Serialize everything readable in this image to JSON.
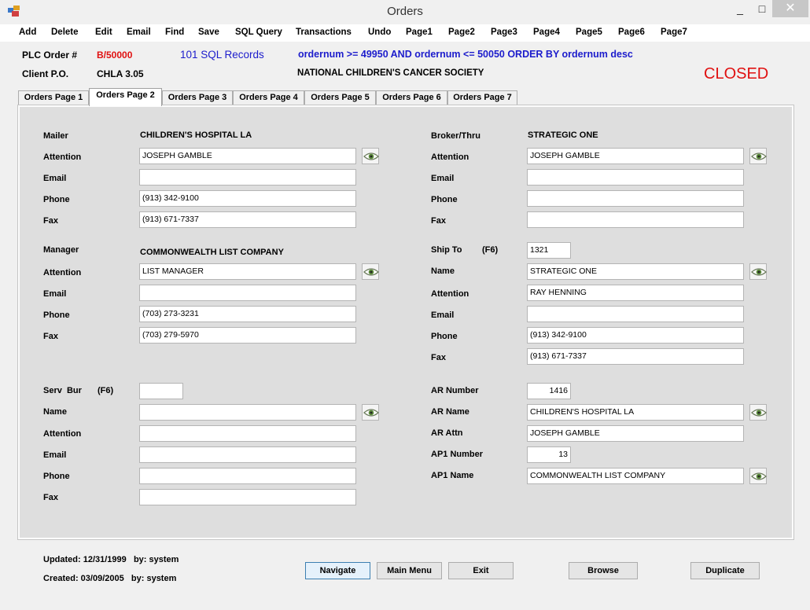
{
  "window": {
    "title": "Orders",
    "minimize": "_",
    "maximize": "□",
    "close": "✕"
  },
  "menu": [
    "Add",
    "Delete",
    "Edit",
    "Email",
    "Find",
    "Save",
    "SQL Query",
    "Transactions",
    "Undo",
    "Page1",
    "Page2",
    "Page3",
    "Page4",
    "Page5",
    "Page6",
    "Page7"
  ],
  "header": {
    "order_label": "PLC Order #",
    "order_value": "B/50000",
    "records": "101 SQL Records",
    "query": "ordernum >= 49950 AND ordernum <= 50050 ORDER BY ordernum desc",
    "client_po_label": "Client P.O.",
    "client_po_value": "CHLA 3.05",
    "client_name": "NATIONAL CHILDREN'S CANCER SOCIETY",
    "status": "CLOSED",
    "status_color": "#e01010",
    "accent_blue": "#1c1ccc"
  },
  "tabs": [
    "Orders Page 1",
    "Orders Page 2",
    "Orders Page 3",
    "Orders Page 4",
    "Orders Page 5",
    "Orders Page 6",
    "Orders Page 7"
  ],
  "active_tab": "Orders Page 2",
  "mailer": {
    "label": "Mailer",
    "name": "CHILDREN'S HOSPITAL LA",
    "attention_label": "Attention",
    "attention": "JOSEPH GAMBLE",
    "email_label": "Email",
    "email": "",
    "phone_label": "Phone",
    "phone": "(913) 342-9100",
    "fax_label": "Fax",
    "fax": "(913) 671-7337"
  },
  "manager": {
    "label": "Manager",
    "name": "COMMONWEALTH LIST COMPANY",
    "attention_label": "Attention",
    "attention": "LIST MANAGER",
    "email_label": "Email",
    "email": "",
    "phone_label": "Phone",
    "phone": "(703) 273-3231",
    "fax_label": "Fax",
    "fax": "(703) 279-5970"
  },
  "serv_bur": {
    "label": "Serv  Bur",
    "key_hint": "(F6)",
    "code": "",
    "name_label": "Name",
    "name": "",
    "attention_label": "Attention",
    "attention": "",
    "email_label": "Email",
    "email": "",
    "phone_label": "Phone",
    "phone": "",
    "fax_label": "Fax",
    "fax": ""
  },
  "broker": {
    "label": "Broker/Thru",
    "name": "STRATEGIC ONE",
    "attention_label": "Attention",
    "attention": "JOSEPH GAMBLE",
    "email_label": "Email",
    "email": "",
    "phone_label": "Phone",
    "phone": "",
    "fax_label": "Fax",
    "fax": ""
  },
  "ship_to": {
    "label": "Ship To",
    "key_hint": "(F6)",
    "code": "1321",
    "name_label": "Name",
    "name": "STRATEGIC ONE",
    "attention_label": "Attention",
    "attention": "RAY HENNING",
    "email_label": "Email",
    "email": "",
    "phone_label": "Phone",
    "phone": "(913) 342-9100",
    "fax_label": "Fax",
    "fax": "(913) 671-7337"
  },
  "ar": {
    "number_label": "AR Number",
    "number": "1416",
    "name_label": "AR Name",
    "name": "CHILDREN'S HOSPITAL LA",
    "attn_label": "AR Attn",
    "attn": "JOSEPH GAMBLE",
    "ap1_number_label": "AP1 Number",
    "ap1_number": "13",
    "ap1_name_label": "AP1 Name",
    "ap1_name": "COMMONWEALTH LIST COMPANY"
  },
  "footer": {
    "updated": "Updated: 12/31/1999   by: system",
    "created": "Created: 03/09/2005   by: system",
    "buttons": [
      "Navigate",
      "Main Menu",
      "Exit",
      "Browse",
      "Duplicate"
    ]
  }
}
